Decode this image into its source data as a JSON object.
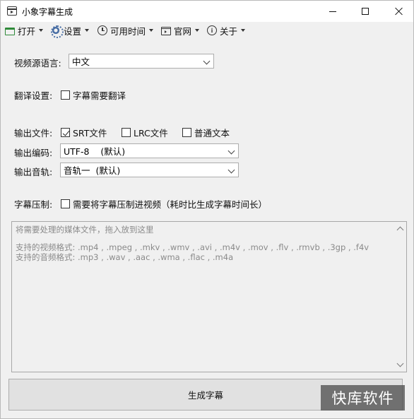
{
  "window": {
    "title": "小象字幕生成"
  },
  "menu": [
    {
      "label": "打开",
      "icon": "folder-icon"
    },
    {
      "label": "设置",
      "icon": "gear-icon"
    },
    {
      "label": "可用时间",
      "icon": "clock-icon"
    },
    {
      "label": "官网",
      "icon": "web-icon"
    },
    {
      "label": "关于",
      "icon": "info-icon"
    }
  ],
  "form": {
    "source_language": {
      "label": "视频源语言:",
      "value": "中文"
    },
    "translate": {
      "label": "翻译设置:",
      "checkbox_label": "字幕需要翻译",
      "checked": false
    },
    "output_file": {
      "label": "输出文件:",
      "options": [
        {
          "label": "SRT文件",
          "checked": true
        },
        {
          "label": "LRC文件",
          "checked": false
        },
        {
          "label": "普通文本",
          "checked": false
        }
      ]
    },
    "output_encoding": {
      "label": "输出编码:",
      "value": "UTF-8    (默认)"
    },
    "output_audio": {
      "label": "输出音轨:",
      "value": "音轨一  (默认)"
    },
    "burn_in": {
      "label": "字幕压制:",
      "checkbox_label": "需要将字幕压制进视频（耗时比生成字幕时间长）",
      "checked": false
    }
  },
  "dropzone": {
    "hint": "将需要处理的媒体文件，拖入放到这里",
    "video_formats": "支持的视频格式: .mp4 , .mpeg , .mkv , .wmv , .avi , .m4v , .mov , .flv , .rmvb , .3gp , .f4v",
    "audio_formats": "支持的音频格式: .mp3 , .wav , .aac , .wma , .flac , .m4a"
  },
  "actions": {
    "generate_label": "生成字幕"
  },
  "watermark": "快库软件"
}
